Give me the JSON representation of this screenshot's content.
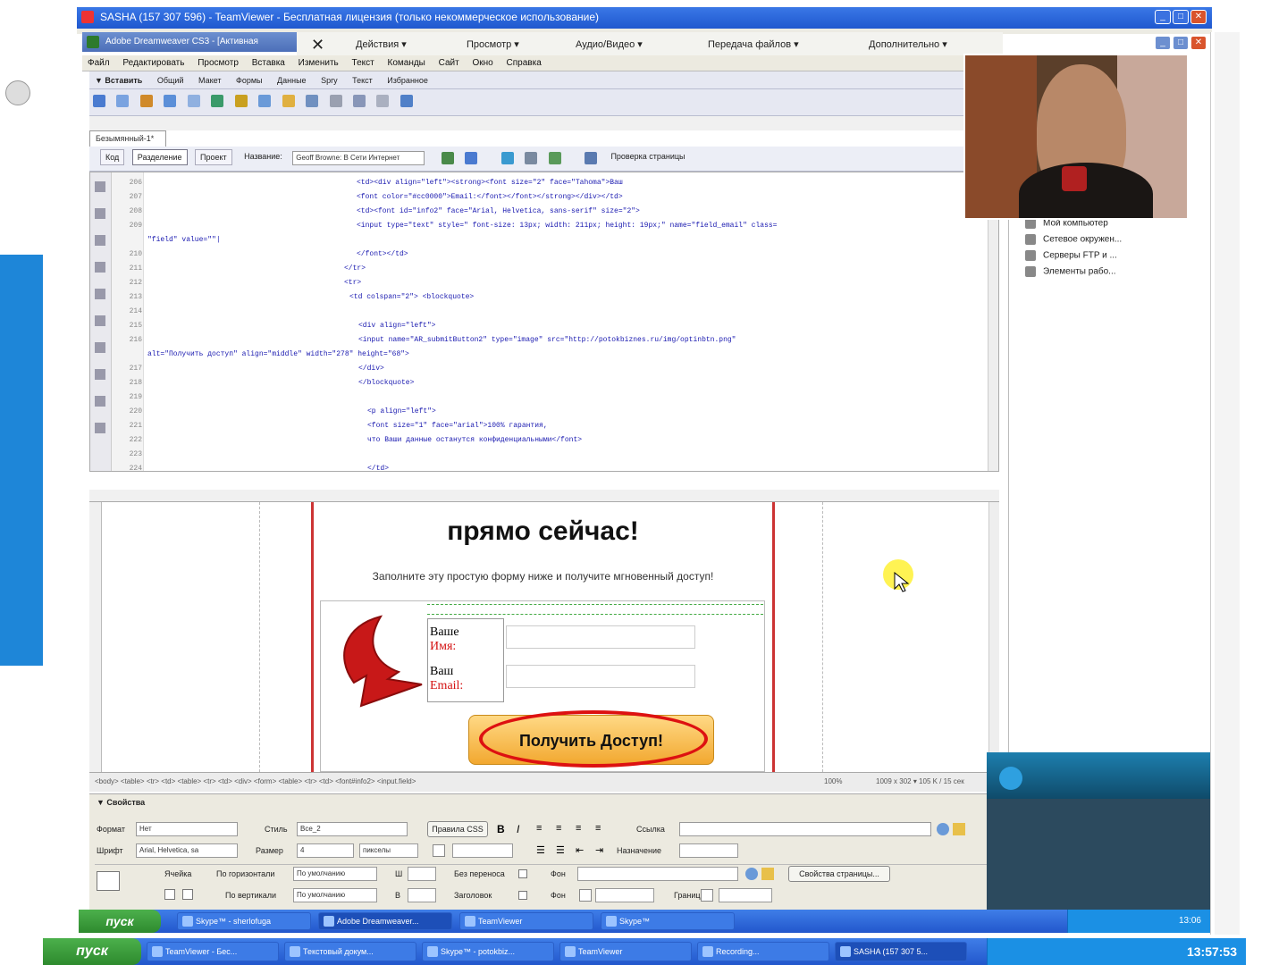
{
  "outer_window": {
    "title": "SASHA (157 307 596) - TeamViewer - Бесплатная лицензия (только некоммерческое использование)"
  },
  "teamviewer_toolbar": {
    "close": "✕",
    "actions": "Действия ▾",
    "view": "Просмотр ▾",
    "audio_video": "Аудио/Видео ▾",
    "file_transfer": "Передача файлов ▾",
    "extras": "Дополнительно ▾"
  },
  "dreamweaver": {
    "title": "Adobe Dreamweaver CS3 - [Активная",
    "menu": [
      "Файл",
      "Редактировать",
      "Просмотр",
      "Вставка",
      "Изменить",
      "Текст",
      "Команды",
      "Сайт",
      "Окно",
      "Справка"
    ],
    "insert_tab": "▼ Вставить",
    "insert_categories": [
      "Общий",
      "Макет",
      "Формы",
      "Данные",
      "Spry",
      "Текст",
      "Избранное"
    ],
    "document_tab": "Безымянный-1*",
    "views": {
      "code": "Код",
      "split": "Разделение",
      "design": "Проект",
      "title_label": "Название:",
      "title_value": "Geoff Browne: В Сети Интернет",
      "check_page": "Проверка страницы"
    },
    "code_lines": [
      {
        "n": "206",
        "t": "<td><div align=\"left\"><strong><font size=\"2\" face=\"Tahoma\">Ваш"
      },
      {
        "n": "207",
        "t": "  <font color=\"#cc0000\">Email:</font></font></strong></div></td>"
      },
      {
        "n": "208",
        "t": "<td><font id=\"info2\" face=\"Arial, Helvetica, sans-serif\" size=\"2\">"
      },
      {
        "n": "209",
        "t": "  <input type=\"text\" style=\" font-size: 13px; width: 211px; height: 19px;\" name=\"field_email\" class="
      },
      {
        "n": "",
        "t": "\"field\" value=\"\"|"
      },
      {
        "n": "210",
        "t": "  </font></td>"
      },
      {
        "n": "211",
        "t": "</tr>"
      },
      {
        "n": "212",
        "t": "<tr>"
      },
      {
        "n": "213",
        "t": "  <td colspan=\"2\"> <blockquote>"
      },
      {
        "n": "214",
        "t": ""
      },
      {
        "n": "215",
        "t": "    <div align=\"left\">"
      },
      {
        "n": "216",
        "t": "      <input name=\"AR_submitButton2\" type=\"image\" src=\"http://potokbiznes.ru/img/optinbtn.png\""
      },
      {
        "n": "",
        "t": "alt=\"Получить доступ\" align=\"middle\" width=\"278\" height=\"68\">"
      },
      {
        "n": "217",
        "t": "    </div>"
      },
      {
        "n": "218",
        "t": "  </blockquote>"
      },
      {
        "n": "219",
        "t": ""
      },
      {
        "n": "220",
        "t": "  <p align=\"left\">"
      },
      {
        "n": "221",
        "t": "    <font size=\"1\" face=\"arial\">100% гарантия,"
      },
      {
        "n": "222",
        "t": "    что Ваши данные останутся конфиденциальными</font>"
      },
      {
        "n": "223",
        "t": ""
      },
      {
        "n": "224",
        "t": "</td>"
      }
    ],
    "design_view": {
      "headline": "прямо сейчас!",
      "subline": "Заполните эту простую форму ниже и получите мгновенный доступ!",
      "name_label_1": "Ваше",
      "name_label_2": "Имя:",
      "email_label_1": "Ваш",
      "email_label_2": "Email:",
      "button_text": "Получить Доступ!"
    },
    "status": {
      "tag_path": "<body> <table> <tr> <td> <table> <tr> <td> <div> <form> <table> <tr> <td> <font#info2> <input.field>",
      "zoom": "100%",
      "size": "1009 x 302 ▾  105 K / 15 сек"
    },
    "properties": {
      "header": "▼ Свойства",
      "format_label": "Формат",
      "format_value": "Нет",
      "style_label": "Стиль",
      "style_value": "Все_2",
      "css_button": "Правила CSS",
      "link_label": "Ссылка",
      "font_label": "Шрифт",
      "font_value": "Arial, Helvetica, sa",
      "size_label": "Размер",
      "size_value": "4",
      "size_unit": "пикселы",
      "target_label": "Назначение",
      "cell_label": "Ячейка",
      "horz_label": "По горизонтали",
      "horz_value": "По умолчанию",
      "vert_label": "По вертикали",
      "vert_value": "По умолчанию",
      "w_label": "Ш",
      "h_label": "В",
      "nowrap_label": "Без переноса",
      "header_cb_label": "Заголовок",
      "bg_label": "Фон",
      "border_label": "Границы",
      "page_props_button": "Свойства страницы..."
    }
  },
  "remote_taskbar": {
    "start": "пуск",
    "tasks": [
      "Skype™ - sherlofuga",
      "Adobe Dreamweaver...",
      "TeamViewer",
      "Skype™"
    ],
    "clock": "13:06"
  },
  "local_taskbar": {
    "start": "пуск",
    "tasks": [
      "TeamViewer - Бес...",
      "Текстовый докум...",
      "Skype™ - potokbiz...",
      "TeamViewer",
      "Recording...",
      "SASHA (157 307 5..."
    ],
    "clock": "13:57:53"
  },
  "file_tree": {
    "items": [
      "Мой компьютер",
      "Сетевое окружен...",
      "Серверы FTP и ...",
      "Элементы рабо..."
    ]
  },
  "colors": {
    "xp_title": "#2a62d8",
    "taskbar": "#2a62d8",
    "start_green": "#3a9a3a",
    "accent_red": "#d41010",
    "button_gold": "#f2b545"
  }
}
